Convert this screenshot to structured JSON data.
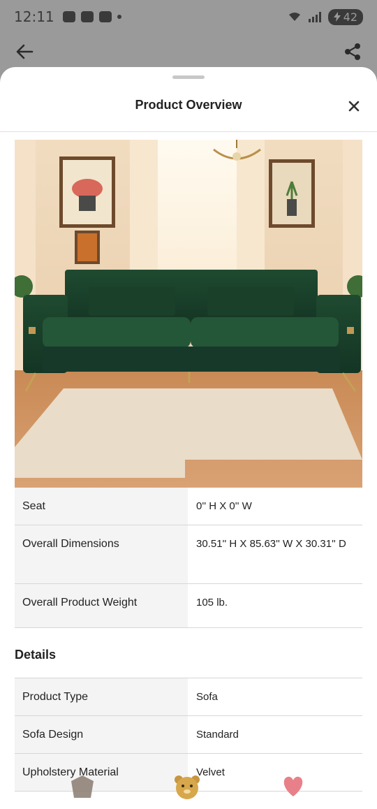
{
  "status_bar": {
    "time": "12:11",
    "battery": "42"
  },
  "sheet": {
    "title": "Product Overview"
  },
  "product_image": {
    "alt": "Green velvet sofa in a sunlit living room",
    "sofa_color": "#1f4a30"
  },
  "specs": [
    {
      "label": "Seat",
      "value": "0'' H X 0'' W"
    },
    {
      "label": "Overall Dimensions",
      "value": "30.51'' H X 85.63'' W X 30.31'' D"
    },
    {
      "label": "Overall Product Weight",
      "value": "105 lb."
    }
  ],
  "details": {
    "heading": "Details",
    "rows": [
      {
        "label": "Product Type",
        "value": "Sofa"
      },
      {
        "label": "Sofa Design",
        "value": "Standard"
      },
      {
        "label": "Upholstery Material",
        "value": "Velvet"
      }
    ]
  }
}
